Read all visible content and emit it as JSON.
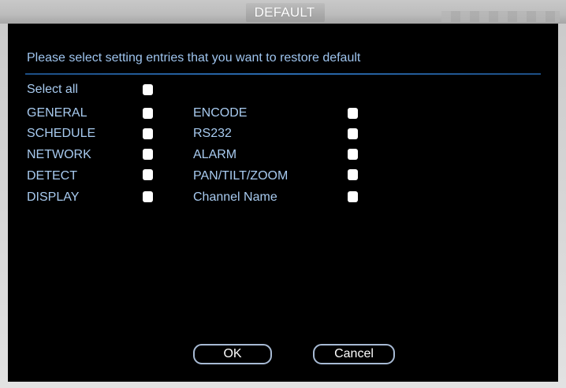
{
  "dialog": {
    "title": "DEFAULT",
    "prompt": "Please select setting entries that you want to restore default",
    "select_all": {
      "label": "Select all",
      "checked": false
    },
    "left_entries": [
      {
        "label": "GENERAL",
        "checked": false
      },
      {
        "label": "SCHEDULE",
        "checked": false
      },
      {
        "label": "NETWORK",
        "checked": false
      },
      {
        "label": "DETECT",
        "checked": false
      },
      {
        "label": "DISPLAY",
        "checked": false
      }
    ],
    "right_entries": [
      {
        "label": "ENCODE",
        "checked": false
      },
      {
        "label": "RS232",
        "checked": false
      },
      {
        "label": "ALARM",
        "checked": false
      },
      {
        "label": "PAN/TILT/ZOOM",
        "checked": false
      },
      {
        "label": "Channel Name",
        "checked": false
      }
    ],
    "buttons": {
      "ok_label": "OK",
      "cancel_label": "Cancel"
    }
  },
  "colors": {
    "panel_background": "#000000",
    "text": "#a8cbf0",
    "divider": "#2a6bb0",
    "title_text": "#ffffff",
    "frame": "#d4d4d4"
  },
  "icons": {
    "checkbox": "checkbox-unchecked-icon"
  }
}
